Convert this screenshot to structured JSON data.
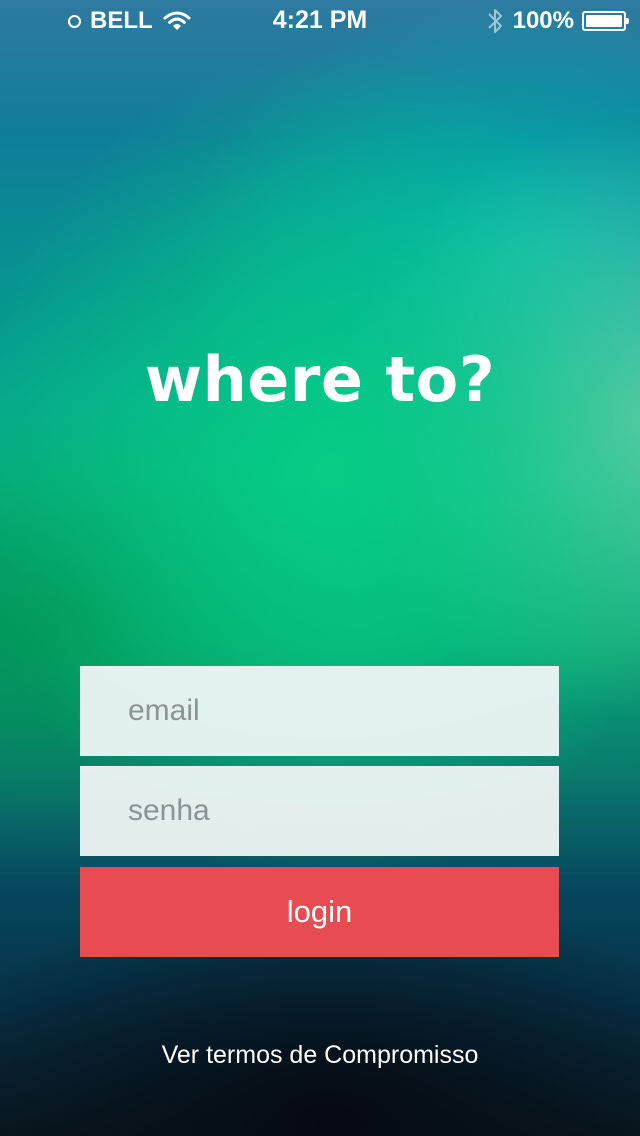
{
  "status_bar": {
    "carrier": "BELL",
    "time": "4:21 PM",
    "battery_percent": "100%",
    "battery_level": 1.0,
    "icons": [
      "signal-icon",
      "wifi-icon",
      "bluetooth-icon",
      "battery-icon"
    ]
  },
  "headline": "where to?",
  "form": {
    "email_placeholder": "email",
    "password_placeholder": "senha",
    "login_label": "login"
  },
  "footer": {
    "terms_link": "Ver termos de Compromisso"
  },
  "colors": {
    "login_button": "#e84c50",
    "field_background": "#f0f7f7",
    "background_green": "#06ce84",
    "background_teal": "#0f7d98"
  }
}
